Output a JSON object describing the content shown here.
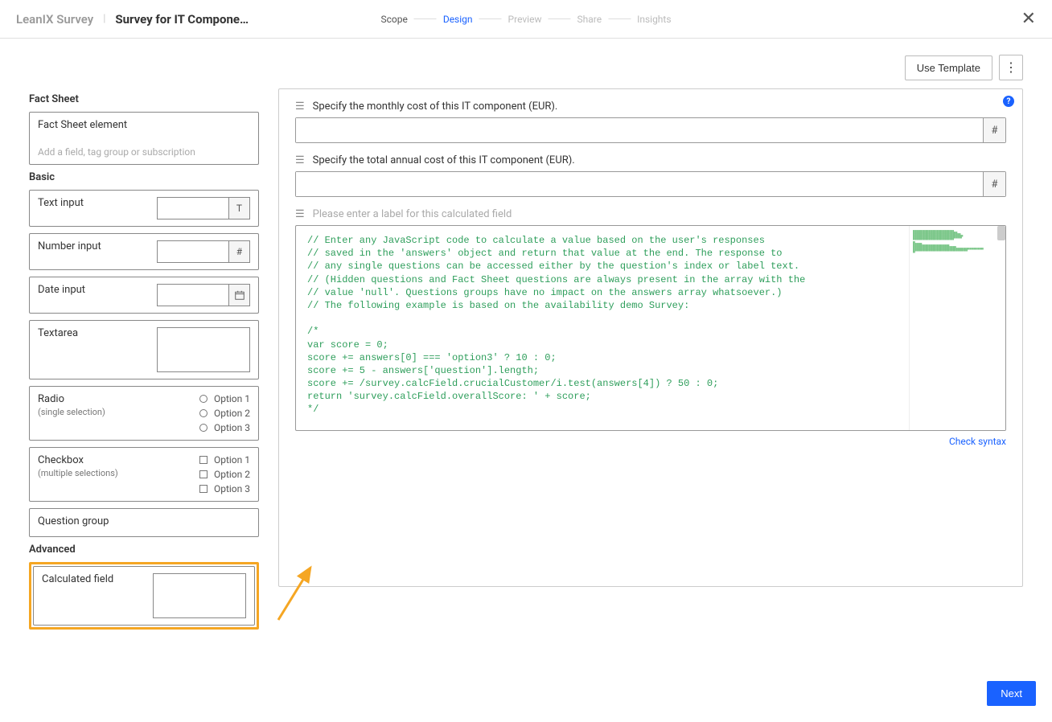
{
  "header": {
    "brand": "LeanIX Survey",
    "title": "Survey for IT Compone…",
    "steps": [
      "Scope",
      "Design",
      "Preview",
      "Share",
      "Insights"
    ],
    "active_step_index": 1
  },
  "toolbar": {
    "use_template": "Use Template"
  },
  "sidebar": {
    "factsheet_section": "Fact Sheet",
    "factsheet_item": {
      "title": "Fact Sheet element",
      "placeholder": "Add a field, tag group or subscription"
    },
    "basic_section": "Basic",
    "basic_items": {
      "text_input": "Text input",
      "text_suffix": "T",
      "number_input": "Number input",
      "number_suffix": "#",
      "date_input": "Date input",
      "textarea": "Textarea",
      "radio": "Radio",
      "radio_sub": "(single selection)",
      "checkbox": "Checkbox",
      "checkbox_sub": "(multiple selections)",
      "options": [
        "Option 1",
        "Option 2",
        "Option 3"
      ],
      "question_group": "Question group"
    },
    "advanced_section": "Advanced",
    "advanced_items": {
      "calculated_field": "Calculated field"
    }
  },
  "canvas": {
    "q1_label": "Specify the monthly cost of this IT component (EUR).",
    "q2_label": "Specify the total annual cost of this IT component (EUR).",
    "number_suffix": "#",
    "calc_placeholder": "Please enter a label for this calculated field",
    "code": "// Enter any JavaScript code to calculate a value based on the user's responses\n// saved in the 'answers' object and return that value at the end. The response to\n// any single questions can be accessed either by the question's index or label text.\n// (Hidden questions and Fact Sheet questions are always present in the array with the\n// value 'null'. Questions groups have no impact on the answers array whatsoever.)\n// The following example is based on the availability demo Survey:\n\n/*\nvar score = 0;\nscore += answers[0] === 'option3' ? 10 : 0;\nscore += 5 - answers['question'].length;\nscore += /survey.calcField.crucialCustomer/i.test(answers[4]) ? 50 : 0;\nreturn 'survey.calcField.overallScore: ' + score;\n*/",
    "check_syntax": "Check syntax"
  },
  "footer": {
    "next": "Next"
  }
}
